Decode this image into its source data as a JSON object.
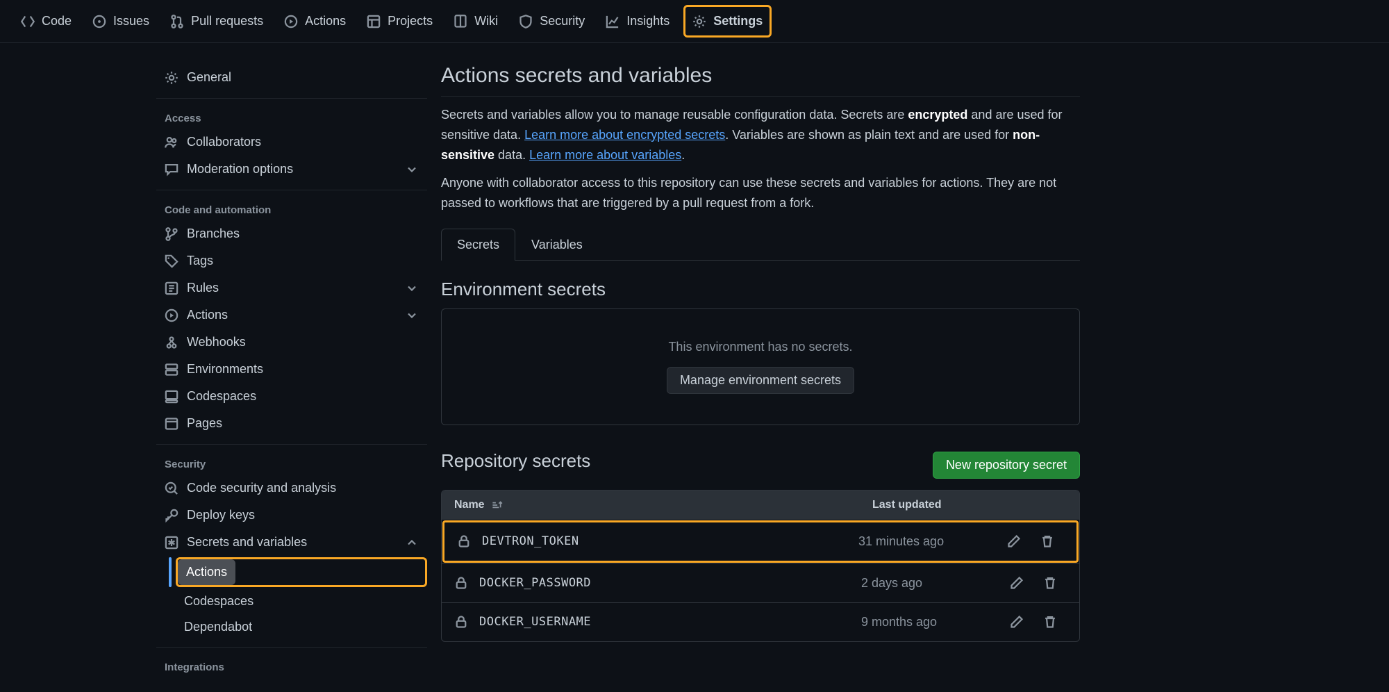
{
  "topnav": {
    "code": "Code",
    "issues": "Issues",
    "pulls": "Pull requests",
    "actions": "Actions",
    "projects": "Projects",
    "wiki": "Wiki",
    "security": "Security",
    "insights": "Insights",
    "settings": "Settings"
  },
  "sidebar": {
    "general": "General",
    "access_heading": "Access",
    "collaborators": "Collaborators",
    "moderation": "Moderation options",
    "code_auto_heading": "Code and automation",
    "branches": "Branches",
    "tags": "Tags",
    "rules": "Rules",
    "actions": "Actions",
    "webhooks": "Webhooks",
    "environments": "Environments",
    "codespaces": "Codespaces",
    "pages": "Pages",
    "security_heading": "Security",
    "code_sec": "Code security and analysis",
    "deploy_keys": "Deploy keys",
    "secrets_vars": "Secrets and variables",
    "sv_actions": "Actions",
    "sv_codespaces": "Codespaces",
    "sv_dependabot": "Dependabot",
    "integrations_heading": "Integrations"
  },
  "main": {
    "title": "Actions secrets and variables",
    "desc1_a": "Secrets and variables allow you to manage reusable configuration data. Secrets are ",
    "desc1_b": "encrypted",
    "desc1_c": " and are used for sensitive data. ",
    "desc1_link1": "Learn more about encrypted secrets",
    "desc1_d": ". Variables are shown as plain text and are used for ",
    "desc1_e": "non-sensitive",
    "desc1_f": " data. ",
    "desc1_link2": "Learn more about variables",
    "desc1_g": ".",
    "desc2": "Anyone with collaborator access to this repository can use these secrets and variables for actions. They are not passed to workflows that are triggered by a pull request from a fork.",
    "tabs": {
      "secrets": "Secrets",
      "variables": "Variables"
    },
    "env_title": "Environment secrets",
    "env_empty": "This environment has no secrets.",
    "env_btn": "Manage environment secrets",
    "repo_title": "Repository secrets",
    "new_btn": "New repository secret",
    "th_name": "Name",
    "th_updated": "Last updated",
    "rows": [
      {
        "name": "DEVTRON_TOKEN",
        "updated": "31 minutes ago"
      },
      {
        "name": "DOCKER_PASSWORD",
        "updated": "2 days ago"
      },
      {
        "name": "DOCKER_USERNAME",
        "updated": "9 months ago"
      }
    ]
  }
}
